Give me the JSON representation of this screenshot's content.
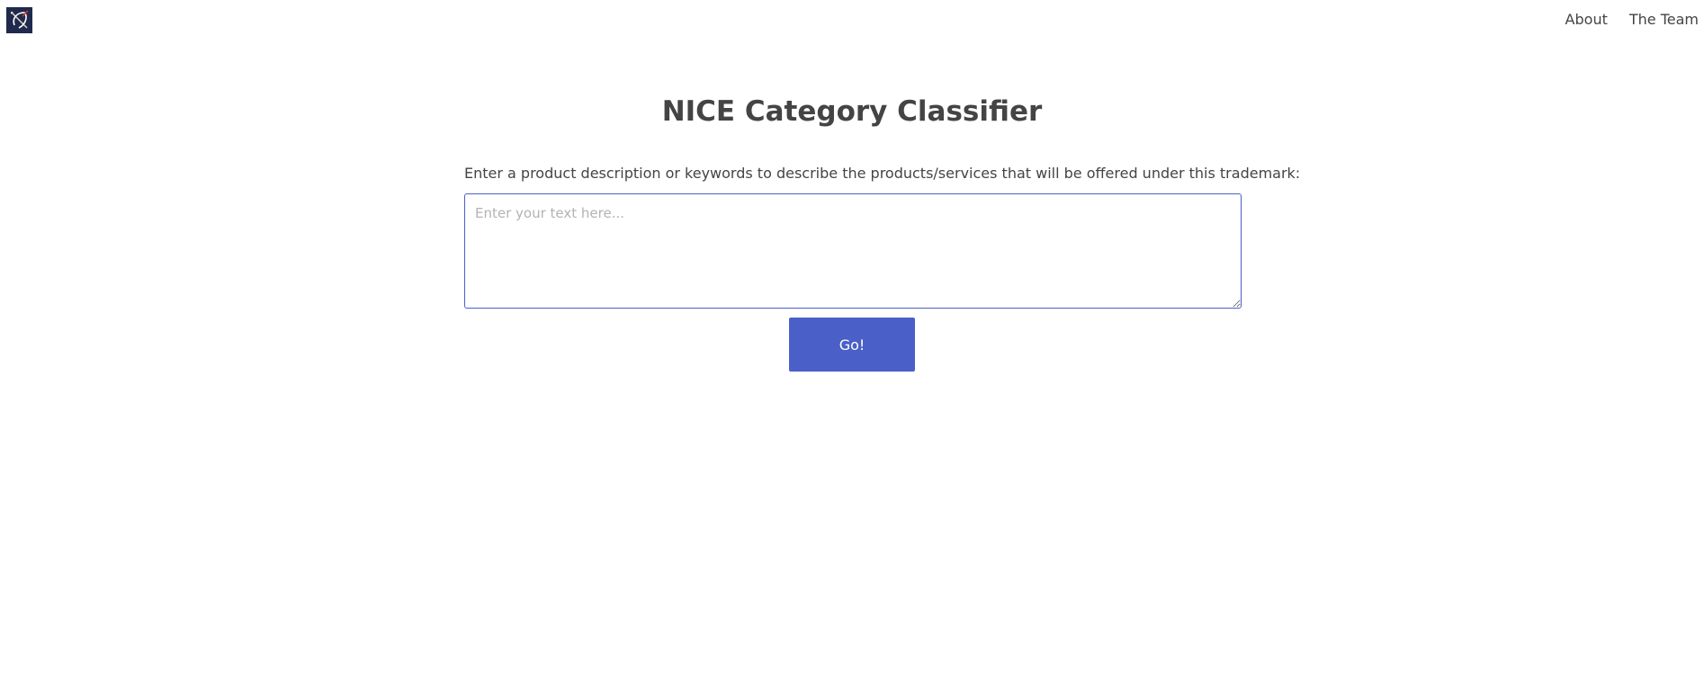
{
  "header": {
    "logo_icon": "logo-bow-icon",
    "nav": {
      "about": "About",
      "team": "The Team"
    }
  },
  "main": {
    "title": "NICE Category Classifier",
    "prompt": "Enter a product description or keywords to describe the products/services that will be offered under this trademark:",
    "input": {
      "placeholder": "Enter your text here...",
      "value": ""
    },
    "submit_label": "Go!"
  },
  "colors": {
    "accent": "#4a5fc7",
    "text": "#444444",
    "logo_bg": "#1f2a4d"
  }
}
